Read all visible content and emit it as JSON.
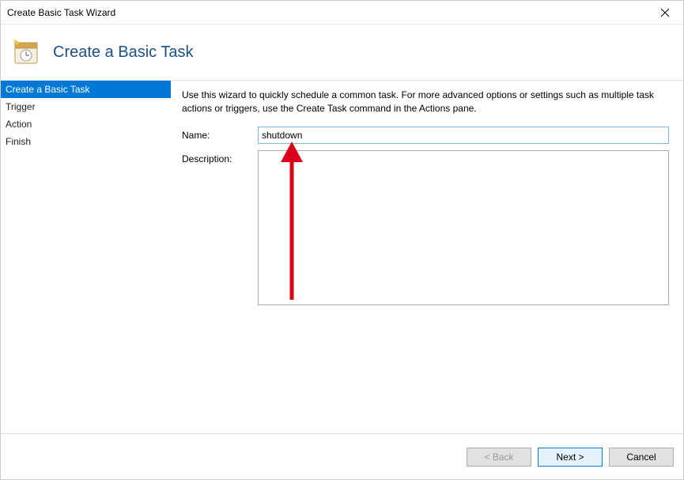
{
  "window": {
    "title": "Create Basic Task Wizard"
  },
  "header": {
    "page_title": "Create a Basic Task"
  },
  "sidebar": {
    "items": [
      {
        "label": "Create a Basic Task",
        "active": true
      },
      {
        "label": "Trigger",
        "active": false
      },
      {
        "label": "Action",
        "active": false
      },
      {
        "label": "Finish",
        "active": false
      }
    ]
  },
  "content": {
    "intro": "Use this wizard to quickly schedule a common task.  For more advanced options or settings such as multiple task actions or triggers, use the Create Task command in the Actions pane.",
    "name_label": "Name:",
    "name_value": "shutdown",
    "description_label": "Description:",
    "description_value": ""
  },
  "footer": {
    "back_label": "< Back",
    "next_label": "Next >",
    "cancel_label": "Cancel"
  }
}
